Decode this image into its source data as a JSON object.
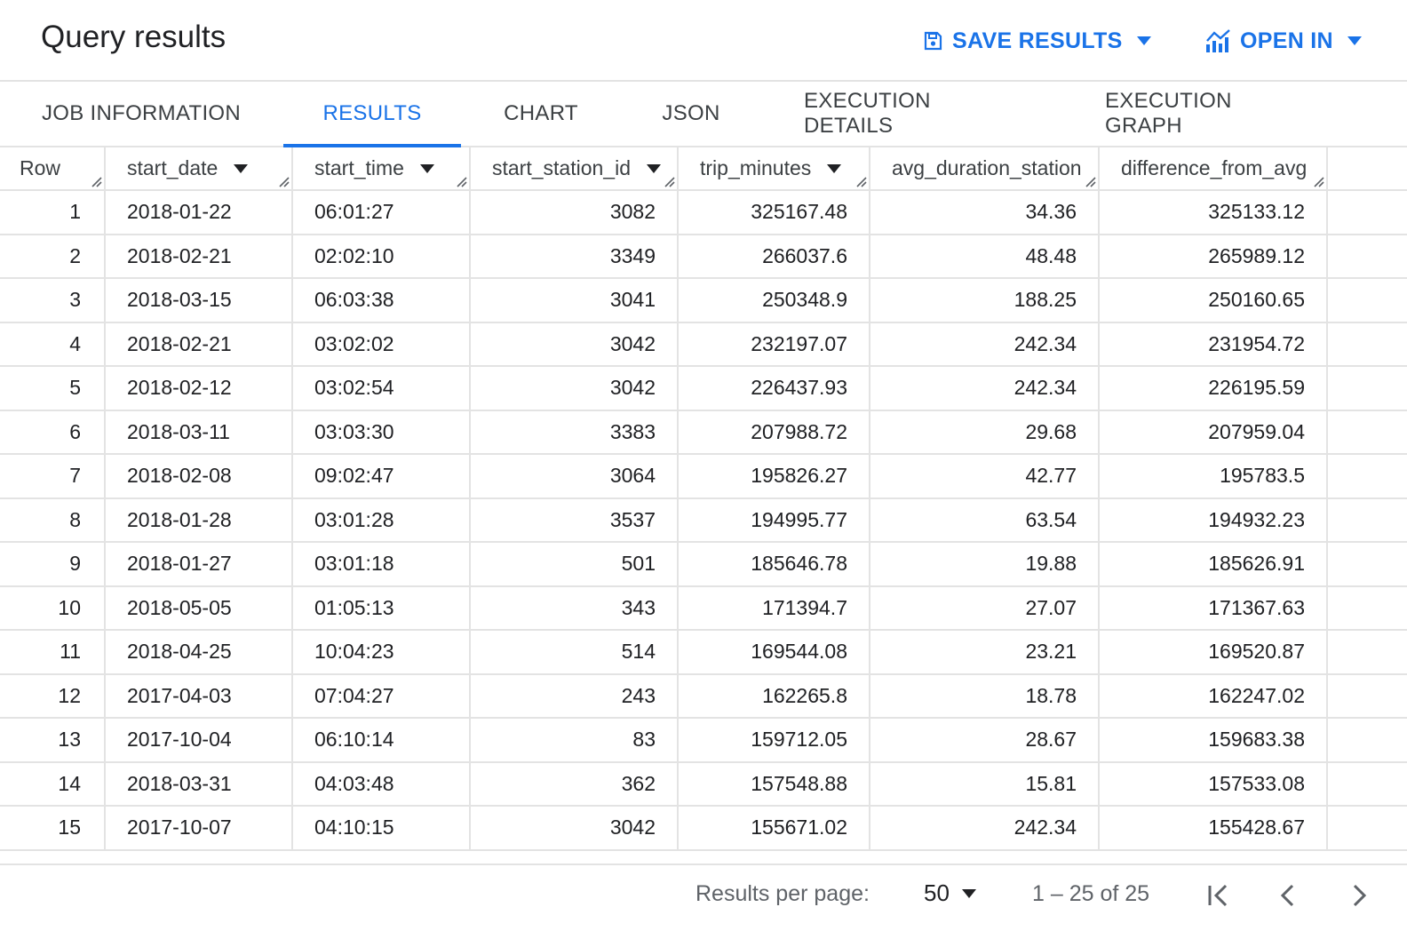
{
  "header": {
    "title": "Query results",
    "save_results_label": "SAVE RESULTS",
    "open_in_label": "OPEN IN"
  },
  "tabs": [
    {
      "label": "JOB INFORMATION",
      "active": false
    },
    {
      "label": "RESULTS",
      "active": true
    },
    {
      "label": "CHART",
      "active": false
    },
    {
      "label": "JSON",
      "active": false
    },
    {
      "label": "EXECUTION DETAILS",
      "active": false
    },
    {
      "label": "EXECUTION GRAPH",
      "active": false
    }
  ],
  "table": {
    "columns": [
      "Row",
      "start_date",
      "start_time",
      "start_station_id",
      "trip_minutes",
      "avg_duration_station",
      "difference_from_avg"
    ],
    "rows": [
      [
        "1",
        "2018-01-22",
        "06:01:27",
        "3082",
        "325167.48",
        "34.36",
        "325133.12"
      ],
      [
        "2",
        "2018-02-21",
        "02:02:10",
        "3349",
        "266037.6",
        "48.48",
        "265989.12"
      ],
      [
        "3",
        "2018-03-15",
        "06:03:38",
        "3041",
        "250348.9",
        "188.25",
        "250160.65"
      ],
      [
        "4",
        "2018-02-21",
        "03:02:02",
        "3042",
        "232197.07",
        "242.34",
        "231954.72"
      ],
      [
        "5",
        "2018-02-12",
        "03:02:54",
        "3042",
        "226437.93",
        "242.34",
        "226195.59"
      ],
      [
        "6",
        "2018-03-11",
        "03:03:30",
        "3383",
        "207988.72",
        "29.68",
        "207959.04"
      ],
      [
        "7",
        "2018-02-08",
        "09:02:47",
        "3064",
        "195826.27",
        "42.77",
        "195783.5"
      ],
      [
        "8",
        "2018-01-28",
        "03:01:28",
        "3537",
        "194995.77",
        "63.54",
        "194932.23"
      ],
      [
        "9",
        "2018-01-27",
        "03:01:18",
        "501",
        "185646.78",
        "19.88",
        "185626.91"
      ],
      [
        "10",
        "2018-05-05",
        "01:05:13",
        "343",
        "171394.7",
        "27.07",
        "171367.63"
      ],
      [
        "11",
        "2018-04-25",
        "10:04:23",
        "514",
        "169544.08",
        "23.21",
        "169520.87"
      ],
      [
        "12",
        "2017-04-03",
        "07:04:27",
        "243",
        "162265.8",
        "18.78",
        "162247.02"
      ],
      [
        "13",
        "2017-10-04",
        "06:10:14",
        "83",
        "159712.05",
        "28.67",
        "159683.38"
      ],
      [
        "14",
        "2018-03-31",
        "04:03:48",
        "362",
        "157548.88",
        "15.81",
        "157533.08"
      ],
      [
        "15",
        "2017-10-07",
        "04:10:15",
        "3042",
        "155671.02",
        "242.34",
        "155428.67"
      ]
    ]
  },
  "footer": {
    "results_per_page_label": "Results per page:",
    "results_per_page_value": "50",
    "range_text": "1 – 25 of 25"
  },
  "colors": {
    "accent": "#1a73e8",
    "border": "#e3e3e3",
    "text": "#202124",
    "muted": "#5f6368"
  },
  "icons": {
    "save": "save-icon",
    "open_in": "chart-icon",
    "dropdown": "caret-down-icon",
    "sort": "sort-down-icon",
    "resize": "resize-grip-icon",
    "first_page": "first-page-icon",
    "prev_page": "chevron-left-icon",
    "next_page": "chevron-right-icon"
  }
}
